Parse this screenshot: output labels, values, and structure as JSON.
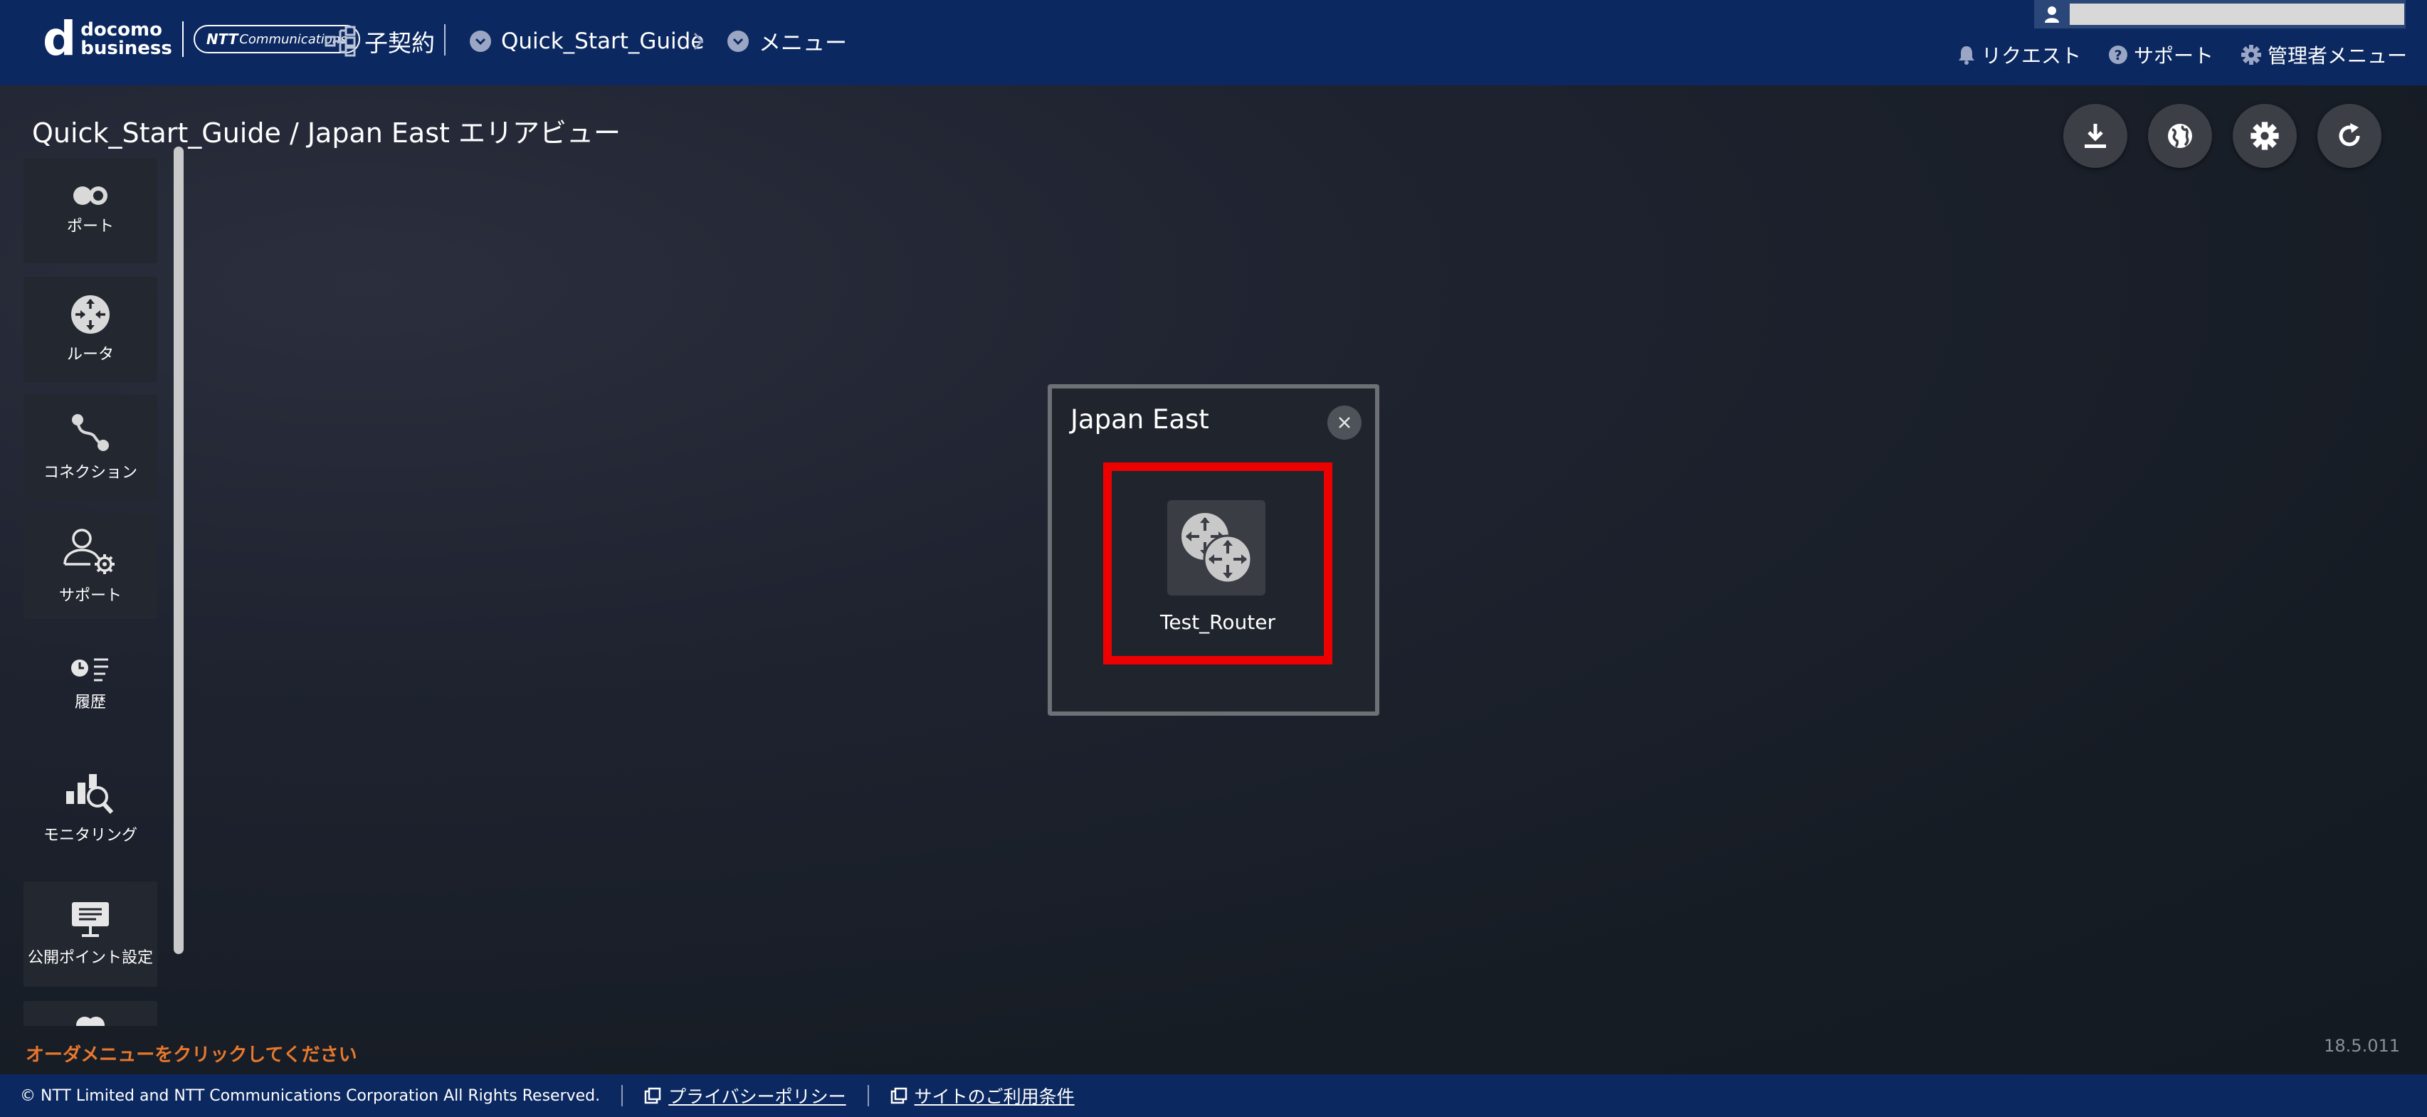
{
  "header": {
    "logo": {
      "d": "d",
      "line1": "docomo",
      "line2": "business",
      "ntt_brand": "NTT",
      "ntt_sub": "Communications"
    },
    "contract_label": "子契約",
    "guide_label": "Quick_Start_Guide",
    "arrow": ">",
    "menu_label": "メニュー",
    "links": {
      "request": "リクエスト",
      "support": "サポート",
      "admin_menu": "管理者メニュー"
    }
  },
  "page_title": "Quick_Start_Guide / Japan East エリアビュー",
  "sidebar": {
    "items": [
      {
        "label": "ポート",
        "icon": "port-icon"
      },
      {
        "label": "ルータ",
        "icon": "router-icon"
      },
      {
        "label": "コネクション",
        "icon": "connection-icon"
      },
      {
        "label": "サポート",
        "icon": "support-user-icon"
      },
      {
        "label": "履歴",
        "icon": "history-icon"
      },
      {
        "label": "モニタリング",
        "icon": "monitoring-icon"
      },
      {
        "label": "公開ポイント設定",
        "icon": "public-point-icon"
      }
    ]
  },
  "area": {
    "title": "Japan East",
    "router_name": "Test_Router"
  },
  "hint": "オーダメニューをクリックしてください",
  "version": "18.5.011",
  "footer": {
    "copyright": "© NTT Limited and NTT Communications Corporation All Rights Reserved.",
    "privacy": "プライバシーポリシー",
    "terms": "サイトのご利用条件"
  },
  "colors": {
    "header_bg": "#0b2860",
    "highlight": "#ec0000",
    "hint_text": "#e8782c"
  }
}
